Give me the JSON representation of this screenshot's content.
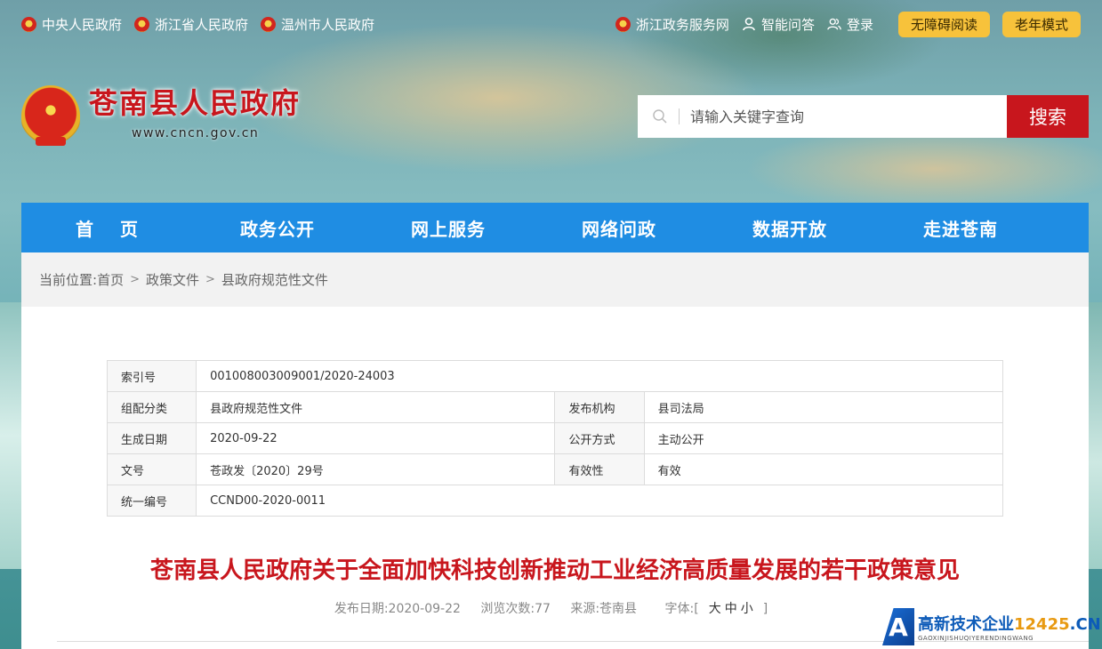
{
  "topbar": {
    "left_links": [
      {
        "label": "中央人民政府"
      },
      {
        "label": "浙江省人民政府"
      },
      {
        "label": "温州市人民政府"
      }
    ],
    "service_link": "浙江政务服务网",
    "qa_link": "智能问答",
    "login_link": "登录",
    "accessibility_button": "无障碍阅读",
    "elder_button": "老年模式"
  },
  "header": {
    "site_name": "苍南县人民政府",
    "site_url": "www.cncn.gov.cn"
  },
  "search": {
    "placeholder": "请输入关键字查询",
    "button": "搜索"
  },
  "nav": {
    "items": [
      "首页",
      "政务公开",
      "网上服务",
      "网络问政",
      "数据开放",
      "走进苍南"
    ]
  },
  "breadcrumb": {
    "prefix": "当前位置:",
    "items": [
      "首页",
      "政策文件",
      "县政府规范性文件"
    ],
    "separator": ">"
  },
  "meta": {
    "index_label": "索引号",
    "index_value": "001008003009001/2020-24003",
    "category_label": "组配分类",
    "category_value": "县政府规范性文件",
    "publisher_label": "发布机构",
    "publisher_value": "县司法局",
    "date_label": "生成日期",
    "date_value": "2020-09-22",
    "open_label": "公开方式",
    "open_value": "主动公开",
    "doc_label": "文号",
    "doc_value": "苍政发〔2020〕29号",
    "valid_label": "有效性",
    "valid_value": "有效",
    "code_label": "统一编号",
    "code_value": "CCND00-2020-0011"
  },
  "article": {
    "title": "苍南县人民政府关于全面加快科技创新推动工业经济高质量发展的若干政策意见",
    "pub_date": "发布日期:2020-09-22",
    "views": "浏览次数:77",
    "source": "来源:苍南县",
    "font_label": "字体:[",
    "font_large": "大",
    "font_medium": "中",
    "font_small": "小",
    "font_end": "]"
  },
  "watermark": {
    "letter": "A",
    "main": "高新技术企业",
    "num": "12425",
    "suffix": ".CN",
    "sub": "GAOXINJISHUQIYERENDINGWANG"
  },
  "colors": {
    "brand_red": "#c8161d",
    "nav_blue": "#1f8de3",
    "pill_yellow": "#f7c23b"
  }
}
